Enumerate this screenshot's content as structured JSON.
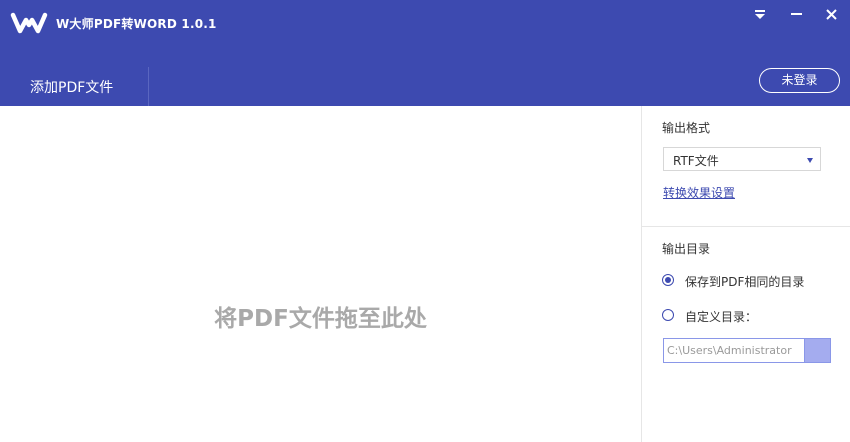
{
  "app": {
    "title": "W大师PDF转WORD 1.0.1",
    "logo_icon": "w-logo"
  },
  "window_controls": {
    "menu_icon": "dropdown-menu-icon",
    "minimize_icon": "minimize-icon",
    "close_icon": "close-icon"
  },
  "toolbar": {
    "add_pdf_label": "添加PDF文件",
    "login_label": "未登录"
  },
  "drop_zone": {
    "hint": "将PDF文件拖至此处"
  },
  "output_format": {
    "label": "输出格式",
    "selected": "RTF文件",
    "effect_settings_link": "转换效果设置"
  },
  "output_dir": {
    "label": "输出目录",
    "options": [
      {
        "label": "保存到PDF相同的目录",
        "checked": true
      },
      {
        "label": "自定义目录：",
        "checked": false
      }
    ],
    "path_value": "C:\\Users\\Administrator"
  },
  "colors": {
    "header": "#3d4ab0",
    "accent": "#3d4ab0",
    "browse_button": "#a4acef",
    "drop_hint": "#a9a9a9"
  }
}
